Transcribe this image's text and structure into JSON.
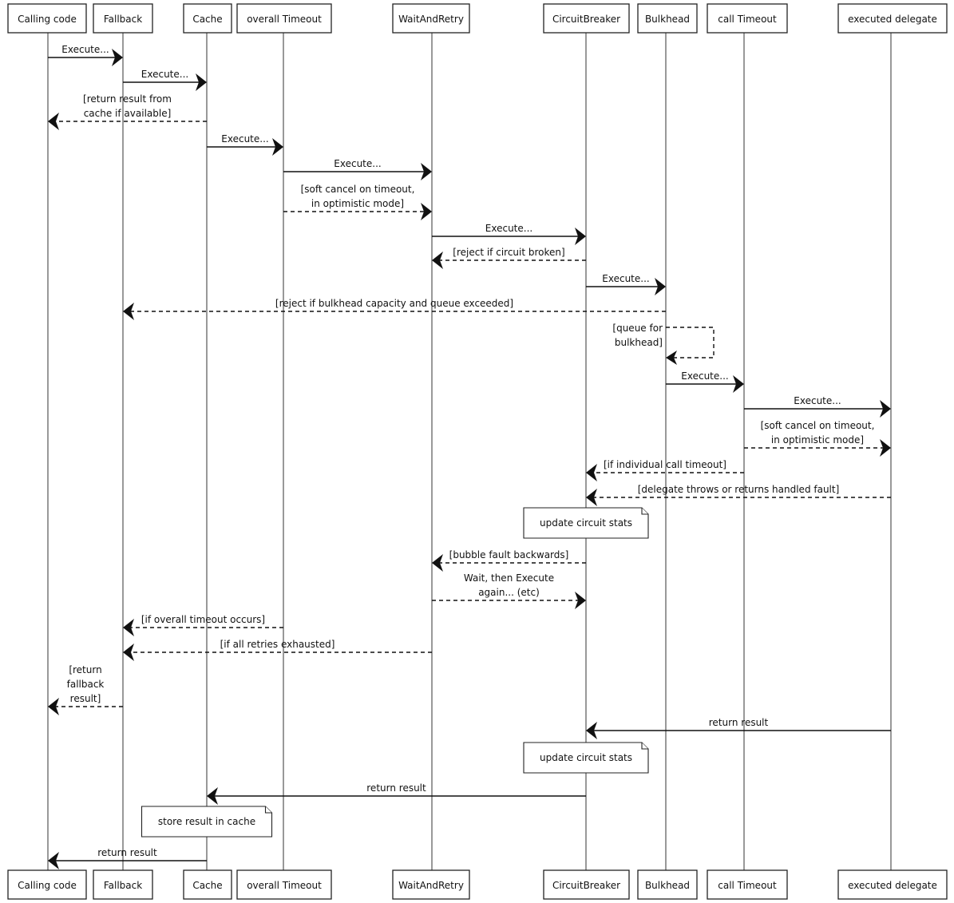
{
  "participants": [
    "Calling code",
    "Fallback",
    "Cache",
    "overall Timeout",
    "WaitAndRetry",
    "CircuitBreaker",
    "Bulkhead",
    "call Timeout",
    "executed delegate"
  ],
  "messages": [
    {
      "from": 0,
      "to": 1,
      "style": "solid",
      "label": [
        "Execute..."
      ]
    },
    {
      "from": 1,
      "to": 2,
      "style": "solid",
      "label": [
        "Execute..."
      ]
    },
    {
      "from": 2,
      "to": 0,
      "style": "dashed",
      "label": [
        "[return result from",
        "cache if available]"
      ]
    },
    {
      "from": 2,
      "to": 3,
      "style": "solid",
      "label": [
        "Execute..."
      ]
    },
    {
      "from": 3,
      "to": 4,
      "style": "solid",
      "label": [
        "Execute..."
      ]
    },
    {
      "from": 3,
      "to": 4,
      "style": "dashed",
      "label": [
        "[soft cancel on timeout,",
        "in optimistic mode]"
      ]
    },
    {
      "from": 4,
      "to": 5,
      "style": "solid",
      "label": [
        "Execute..."
      ]
    },
    {
      "from": 5,
      "to": 4,
      "style": "dashed",
      "label": [
        "[reject if circuit broken]"
      ]
    },
    {
      "from": 5,
      "to": 6,
      "style": "solid",
      "label": [
        "Execute..."
      ]
    },
    {
      "from": 6,
      "to": 1,
      "style": "dashed",
      "label": [
        "[reject if bulkhead capacity and queue exceeded]"
      ]
    },
    {
      "from": 6,
      "to": 6,
      "style": "dashed",
      "label": [
        "[queue for",
        "bulkhead]"
      ]
    },
    {
      "from": 6,
      "to": 7,
      "style": "solid",
      "label": [
        "Execute..."
      ]
    },
    {
      "from": 7,
      "to": 8,
      "style": "solid",
      "label": [
        "Execute..."
      ]
    },
    {
      "from": 7,
      "to": 8,
      "style": "dashed",
      "label": [
        "[soft cancel on timeout,",
        "in optimistic mode]"
      ]
    },
    {
      "from": 7,
      "to": 5,
      "style": "dashed",
      "label": [
        "[if individual call timeout]"
      ]
    },
    {
      "from": 8,
      "to": 5,
      "style": "dashed",
      "label": [
        "[delegate throws or returns handled fault]"
      ]
    },
    {
      "note": 5,
      "label": [
        "update circuit stats"
      ]
    },
    {
      "from": 5,
      "to": 4,
      "style": "dashed",
      "label": [
        "[bubble fault backwards]"
      ]
    },
    {
      "from": 4,
      "to": 5,
      "style": "dashed",
      "label": [
        "Wait, then Execute",
        "again... (etc)"
      ]
    },
    {
      "from": 3,
      "to": 1,
      "style": "dashed",
      "label": [
        "[if overall timeout occurs]"
      ]
    },
    {
      "from": 4,
      "to": 1,
      "style": "dashed",
      "label": [
        "[if all retries exhausted]"
      ]
    },
    {
      "from": 1,
      "to": 0,
      "style": "dashed",
      "label": [
        "[return",
        "fallback",
        "result]"
      ]
    },
    {
      "from": 8,
      "to": 5,
      "style": "solid",
      "label": [
        "return result"
      ]
    },
    {
      "note": 5,
      "label": [
        "update circuit stats"
      ]
    },
    {
      "from": 5,
      "to": 2,
      "style": "solid",
      "label": [
        "return result"
      ]
    },
    {
      "note": 2,
      "label": [
        "store result in cache"
      ]
    },
    {
      "from": 2,
      "to": 0,
      "style": "solid",
      "label": [
        "return result"
      ]
    }
  ]
}
